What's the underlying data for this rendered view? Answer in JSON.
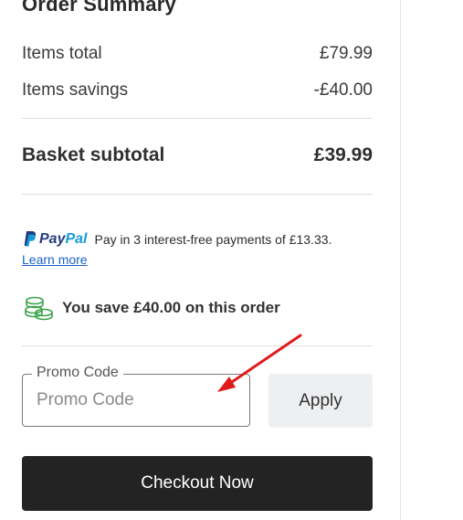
{
  "summary": {
    "title": "Order Summary",
    "items_total_label": "Items total",
    "items_total_value": "£79.99",
    "items_savings_label": "Items savings",
    "items_savings_value": "-£40.00",
    "subtotal_label": "Basket subtotal",
    "subtotal_value": "£39.99"
  },
  "paypal": {
    "logo_word_1": "Pay",
    "logo_word_2": "Pal",
    "message": "Pay in 3 interest-free payments of £13.33.",
    "learn_more": "Learn more"
  },
  "savings": {
    "message": "You save £40.00 on this order",
    "icon": "coins-icon"
  },
  "promo": {
    "label": "Promo Code",
    "placeholder": "Promo Code",
    "value": "",
    "apply_label": "Apply"
  },
  "checkout": {
    "label": "Checkout Now"
  },
  "colors": {
    "checkout_bg": "#232323",
    "apply_bg": "#eeeff1",
    "paypal_dark": "#253b80",
    "paypal_light": "#179bd7",
    "annotation_arrow": "#e01b1b",
    "coins_icon": "#3aa34a"
  }
}
